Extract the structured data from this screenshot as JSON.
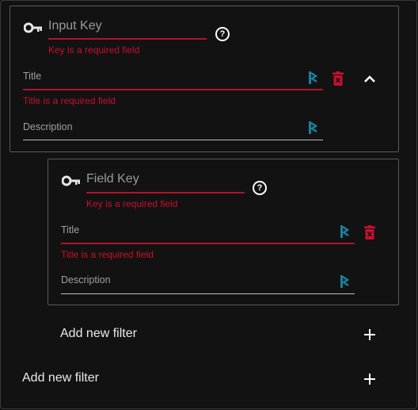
{
  "outer": {
    "key_placeholder": "Input Key",
    "key_error": "Key is a required field",
    "title_label": "Title",
    "title_error": "Title is a required field",
    "description_label": "Description",
    "add_filter_label": "Add new filter"
  },
  "inner": {
    "key_placeholder": "Field Key",
    "key_error": "Key is a required field",
    "title_label": "Title",
    "title_error": "Title is a required field",
    "description_label": "Description",
    "add_filter_label": "Add new filter"
  },
  "icons": {
    "key": "key-icon",
    "help": "help-circle-icon",
    "translate": "teal-translate-icon",
    "delete": "trash-icon",
    "collapse": "chevron-up-icon",
    "add": "plus-icon",
    "help_glyph": "?"
  },
  "colors": {
    "background": "#121212",
    "error": "#c8102e",
    "teal": "#1a7f9a",
    "border": "#5a5a5a"
  }
}
